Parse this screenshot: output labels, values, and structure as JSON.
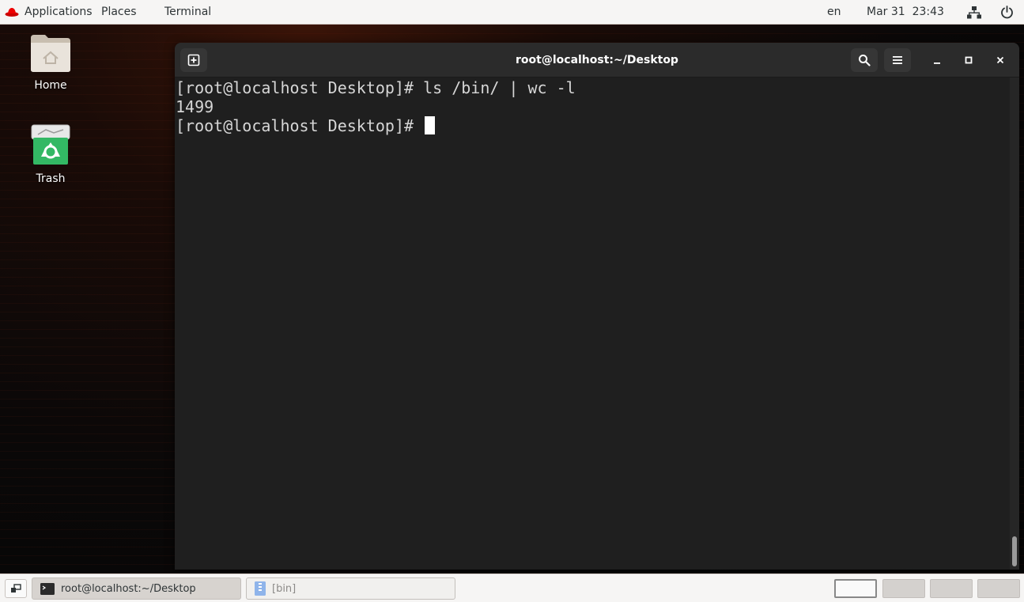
{
  "topbar": {
    "applications": "Applications",
    "places": "Places",
    "terminal": "Terminal",
    "language": "en",
    "datetime": "Mar 31  23:43",
    "icons": [
      "redhat-logo-icon",
      "network-icon",
      "power-icon"
    ]
  },
  "desktop": {
    "home_label": "Home",
    "trash_label": "Trash"
  },
  "window": {
    "title": "root@localhost:~/Desktop",
    "lines": [
      "[root@localhost Desktop]# ls /bin/ | wc -l",
      "1499",
      "[root@localhost Desktop]# "
    ]
  },
  "taskbar": {
    "tasks": [
      {
        "label": "root@localhost:~/Desktop",
        "active": true
      },
      {
        "label": "[bin]",
        "active": false
      }
    ],
    "workspaces": 4,
    "active_workspace": 1
  },
  "colors": {
    "accent_red": "#ee0000",
    "trash_green": "#33b864",
    "terminal_bg": "#1f1f1f",
    "headerbar_bg": "#2b2b2b"
  }
}
